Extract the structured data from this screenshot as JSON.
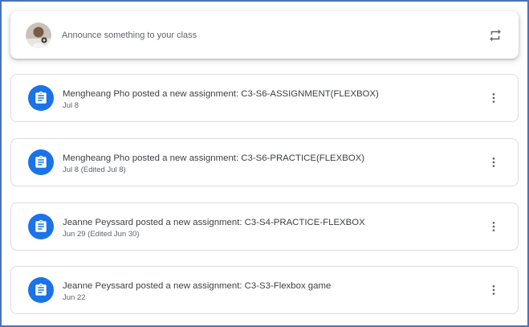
{
  "announce": {
    "placeholder": "Announce something to your class",
    "avatar_icon": "user-avatar",
    "repost_icon": "repost-icon"
  },
  "posts": [
    {
      "title": "Mengheang Pho posted a new assignment: C3-S6-ASSIGNMENT(FLEXBOX)",
      "date": "Jul 8"
    },
    {
      "title": "Mengheang Pho posted a new assignment: C3-S6-PRACTICE(FLEXBOX)",
      "date": "Jul 8 (Edited Jul 8)"
    },
    {
      "title": "Jeanne Peyssard posted a new assignment: C3-S4-PRACTICE-FLEXBOX",
      "date": "Jun 29 (Edited Jun 30)"
    },
    {
      "title": "Jeanne Peyssard posted a new assignment: C3-S3-Flexbox game",
      "date": "Jun 22"
    }
  ],
  "colors": {
    "accent": "#1a73e8",
    "frame_border": "#4a72b8",
    "card_border": "#dadce0",
    "title_text": "#3c4043",
    "secondary_text": "#5f6368"
  },
  "icons": {
    "post_icon": "assignment-icon",
    "menu_icon": "more-vert-icon"
  }
}
